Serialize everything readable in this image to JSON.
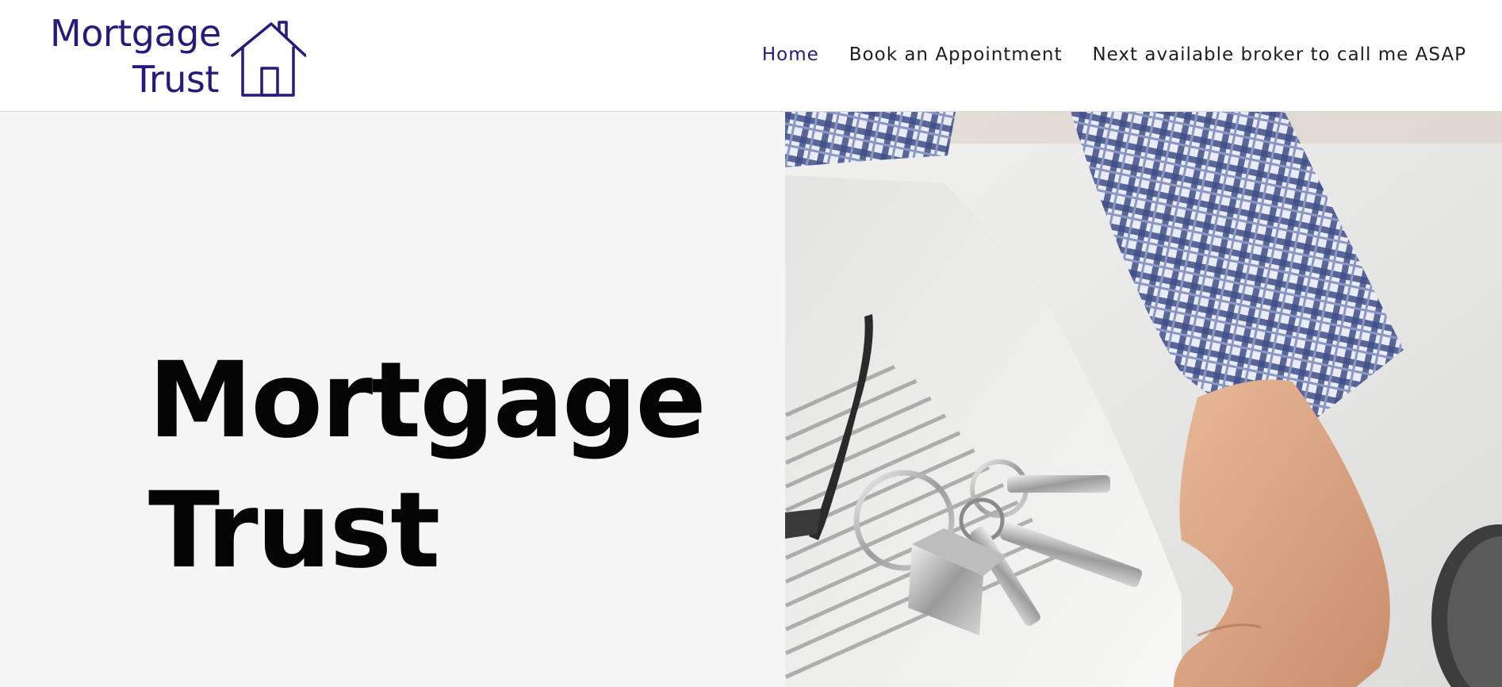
{
  "brand": {
    "logo_line1": "Mortgage",
    "logo_line2": "Trust",
    "logo_icon": "house-icon",
    "brand_color": "#281a78"
  },
  "nav": {
    "items": [
      {
        "label": "Home",
        "active": true
      },
      {
        "label": "Book an Appointment",
        "active": false
      },
      {
        "label": "Next available broker to call me ASAP",
        "active": false
      }
    ]
  },
  "hero": {
    "title_line1": "Mortgage",
    "title_line2": "Trust",
    "background": "#f5f5f5"
  }
}
